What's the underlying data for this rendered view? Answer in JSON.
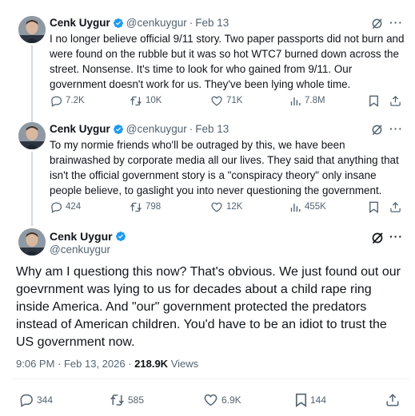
{
  "tweets": [
    {
      "name": "Cenk Uygur",
      "handle": "@cenkuygur",
      "time": "Feb 13",
      "text": "I no longer believe official 9/11 story. Two paper passports did not burn and were found on the rubble but it was so hot WTC7 burned down across the street. Nonsense. It's time to look for who gained from 9/11. Our government doesn't work for us. They've been lying whole time.",
      "replies": "7.2K",
      "reposts": "10K",
      "likes": "71K",
      "views": "7.8M"
    },
    {
      "name": "Cenk Uygur",
      "handle": "@cenkuygur",
      "time": "Feb 13",
      "text": "To my normie friends who'll be outraged by this, we have been brainwashed by corporate media all our lives. They said that anything that isn't the official government story is a \"conspiracy theory\" only insane people believe, to gaslight you into never questioning the government.",
      "replies": "424",
      "reposts": "798",
      "likes": "12K",
      "views": "455K"
    }
  ],
  "main_tweet": {
    "name": "Cenk Uygur",
    "handle": "@cenkuygur",
    "text": "Why am I questiong this now? That's obvious. We just found out our goevrnment was lying to us for decades about a child rape ring inside America. And \"our\" government protected the predators instead of American children. You'd have to be an idiot to trust the US government now.",
    "timestamp": "9:06 PM · Feb 13, 2026 · ",
    "views_count": "218.9K",
    "views_label": "Views",
    "replies": "344",
    "reposts": "585",
    "likes": "6.9K",
    "bookmarks": "144"
  },
  "separator": "·",
  "more_icon": "···",
  "colors": {
    "verified": "#1d9bf0",
    "muted": "#536471",
    "text": "#0f1419",
    "thread_line": "#cfd9de"
  }
}
